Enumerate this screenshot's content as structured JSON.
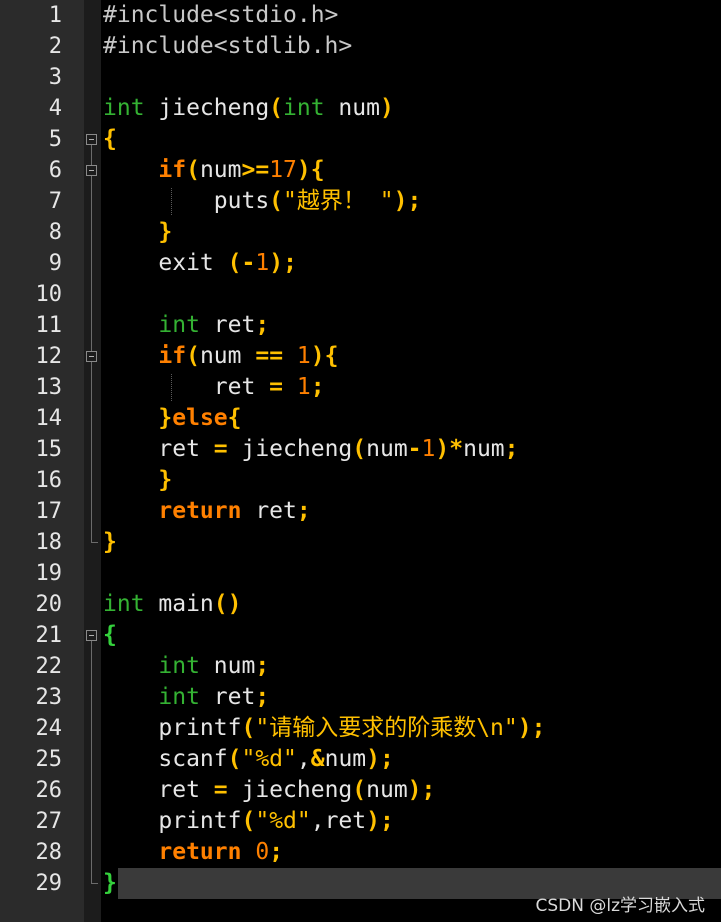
{
  "editor": {
    "lines": [
      {
        "n": "1",
        "tokens": [
          [
            "pre",
            "#include<stdio.h>"
          ]
        ]
      },
      {
        "n": "2",
        "tokens": [
          [
            "pre",
            "#include<stdlib.h>"
          ]
        ]
      },
      {
        "n": "3",
        "tokens": []
      },
      {
        "n": "4",
        "tokens": [
          [
            "type",
            "int"
          ],
          [
            "plain",
            " jiecheng"
          ],
          [
            "paren",
            "("
          ],
          [
            "type",
            "int"
          ],
          [
            "plain",
            " num"
          ],
          [
            "paren",
            ")"
          ]
        ]
      },
      {
        "n": "5",
        "tokens": [
          [
            "brace",
            "{"
          ]
        ]
      },
      {
        "n": "6",
        "tokens": [
          [
            "plain",
            "    "
          ],
          [
            "kw",
            "if"
          ],
          [
            "paren",
            "("
          ],
          [
            "plain",
            "num"
          ],
          [
            "op",
            ">="
          ],
          [
            "num",
            "17"
          ],
          [
            "paren",
            ")"
          ],
          [
            "brace",
            "{"
          ]
        ]
      },
      {
        "n": "7",
        "tokens": [
          [
            "plain",
            "        puts"
          ],
          [
            "paren",
            "("
          ],
          [
            "str",
            "\"越界！ \""
          ],
          [
            "paren",
            ")"
          ],
          [
            "op",
            ";"
          ]
        ]
      },
      {
        "n": "8",
        "tokens": [
          [
            "plain",
            "    "
          ],
          [
            "brace",
            "}"
          ]
        ]
      },
      {
        "n": "9",
        "tokens": [
          [
            "plain",
            "    exit "
          ],
          [
            "paren",
            "("
          ],
          [
            "op",
            "-"
          ],
          [
            "num",
            "1"
          ],
          [
            "paren",
            ")"
          ],
          [
            "op",
            ";"
          ]
        ]
      },
      {
        "n": "10",
        "tokens": []
      },
      {
        "n": "11",
        "tokens": [
          [
            "plain",
            "    "
          ],
          [
            "type",
            "int"
          ],
          [
            "plain",
            " ret"
          ],
          [
            "op",
            ";"
          ]
        ]
      },
      {
        "n": "12",
        "tokens": [
          [
            "plain",
            "    "
          ],
          [
            "kw",
            "if"
          ],
          [
            "paren",
            "("
          ],
          [
            "plain",
            "num "
          ],
          [
            "op",
            "=="
          ],
          [
            "plain",
            " "
          ],
          [
            "num",
            "1"
          ],
          [
            "paren",
            ")"
          ],
          [
            "brace",
            "{"
          ]
        ]
      },
      {
        "n": "13",
        "tokens": [
          [
            "plain",
            "        ret "
          ],
          [
            "op",
            "="
          ],
          [
            "plain",
            " "
          ],
          [
            "num",
            "1"
          ],
          [
            "op",
            ";"
          ]
        ]
      },
      {
        "n": "14",
        "tokens": [
          [
            "plain",
            "    "
          ],
          [
            "brace",
            "}"
          ],
          [
            "kw",
            "else"
          ],
          [
            "brace",
            "{"
          ]
        ]
      },
      {
        "n": "15",
        "tokens": [
          [
            "plain",
            "    ret "
          ],
          [
            "op",
            "="
          ],
          [
            "plain",
            " jiecheng"
          ],
          [
            "paren",
            "("
          ],
          [
            "plain",
            "num"
          ],
          [
            "op",
            "-"
          ],
          [
            "num",
            "1"
          ],
          [
            "paren",
            ")"
          ],
          [
            "op",
            "*"
          ],
          [
            "plain",
            "num"
          ],
          [
            "op",
            ";"
          ]
        ]
      },
      {
        "n": "16",
        "tokens": [
          [
            "plain",
            "    "
          ],
          [
            "brace",
            "}"
          ]
        ]
      },
      {
        "n": "17",
        "tokens": [
          [
            "plain",
            "    "
          ],
          [
            "kw",
            "return"
          ],
          [
            "plain",
            " ret"
          ],
          [
            "op",
            ";"
          ]
        ]
      },
      {
        "n": "18",
        "tokens": [
          [
            "brace",
            "}"
          ]
        ]
      },
      {
        "n": "19",
        "tokens": []
      },
      {
        "n": "20",
        "tokens": [
          [
            "type",
            "int"
          ],
          [
            "plain",
            " main"
          ],
          [
            "paren",
            "()"
          ]
        ]
      },
      {
        "n": "21",
        "tokens": [
          [
            "brace-g",
            "{"
          ]
        ]
      },
      {
        "n": "22",
        "tokens": [
          [
            "plain",
            "    "
          ],
          [
            "type",
            "int"
          ],
          [
            "plain",
            " num"
          ],
          [
            "op",
            ";"
          ]
        ]
      },
      {
        "n": "23",
        "tokens": [
          [
            "plain",
            "    "
          ],
          [
            "type",
            "int"
          ],
          [
            "plain",
            " ret"
          ],
          [
            "op",
            ";"
          ]
        ]
      },
      {
        "n": "24",
        "tokens": [
          [
            "plain",
            "    printf"
          ],
          [
            "paren",
            "("
          ],
          [
            "str",
            "\"请输入要求的阶乘数\\n\""
          ],
          [
            "paren",
            ")"
          ],
          [
            "op",
            ";"
          ]
        ]
      },
      {
        "n": "25",
        "tokens": [
          [
            "plain",
            "    scanf"
          ],
          [
            "paren",
            "("
          ],
          [
            "str",
            "\"%d\""
          ],
          [
            "plain",
            ","
          ],
          [
            "op",
            "&"
          ],
          [
            "plain",
            "num"
          ],
          [
            "paren",
            ")"
          ],
          [
            "op",
            ";"
          ]
        ]
      },
      {
        "n": "26",
        "tokens": [
          [
            "plain",
            "    ret "
          ],
          [
            "op",
            "="
          ],
          [
            "plain",
            " jiecheng"
          ],
          [
            "paren",
            "("
          ],
          [
            "plain",
            "num"
          ],
          [
            "paren",
            ")"
          ],
          [
            "op",
            ";"
          ]
        ]
      },
      {
        "n": "27",
        "tokens": [
          [
            "plain",
            "    printf"
          ],
          [
            "paren",
            "("
          ],
          [
            "str",
            "\"%d\""
          ],
          [
            "plain",
            ",ret"
          ],
          [
            "paren",
            ")"
          ],
          [
            "op",
            ";"
          ]
        ]
      },
      {
        "n": "28",
        "tokens": [
          [
            "plain",
            "    "
          ],
          [
            "kw",
            "return"
          ],
          [
            "plain",
            " "
          ],
          [
            "num",
            "0"
          ],
          [
            "op",
            ";"
          ]
        ]
      },
      {
        "n": "29",
        "tokens": [
          [
            "brace-g",
            "}"
          ]
        ]
      }
    ]
  },
  "watermark": "CSDN @lz学习嵌入式"
}
